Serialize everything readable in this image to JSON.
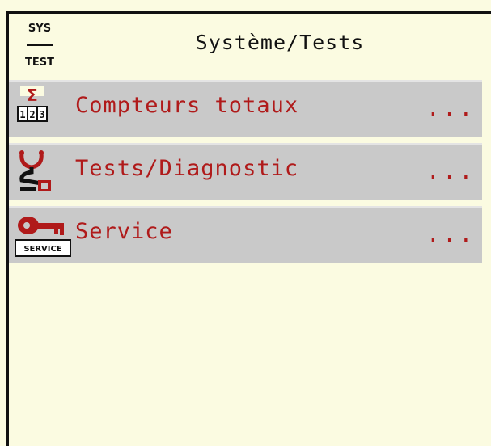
{
  "header": {
    "badge_top": "SYS",
    "badge_bottom": "TEST",
    "title": "Système/Tests"
  },
  "menu": {
    "items": [
      {
        "label": "Compteurs totaux",
        "more": "...",
        "icon": "sigma-counter-icon"
      },
      {
        "label": "Tests/Diagnostic",
        "more": "...",
        "icon": "stethoscope-icon"
      },
      {
        "label": "Service",
        "more": "...",
        "icon": "service-key-icon",
        "icon_text": "SERVICE"
      }
    ]
  },
  "colors": {
    "background": "#fbfbe1",
    "item_background": "#c9c9c9",
    "accent": "#b01a1a",
    "text": "#111111"
  }
}
